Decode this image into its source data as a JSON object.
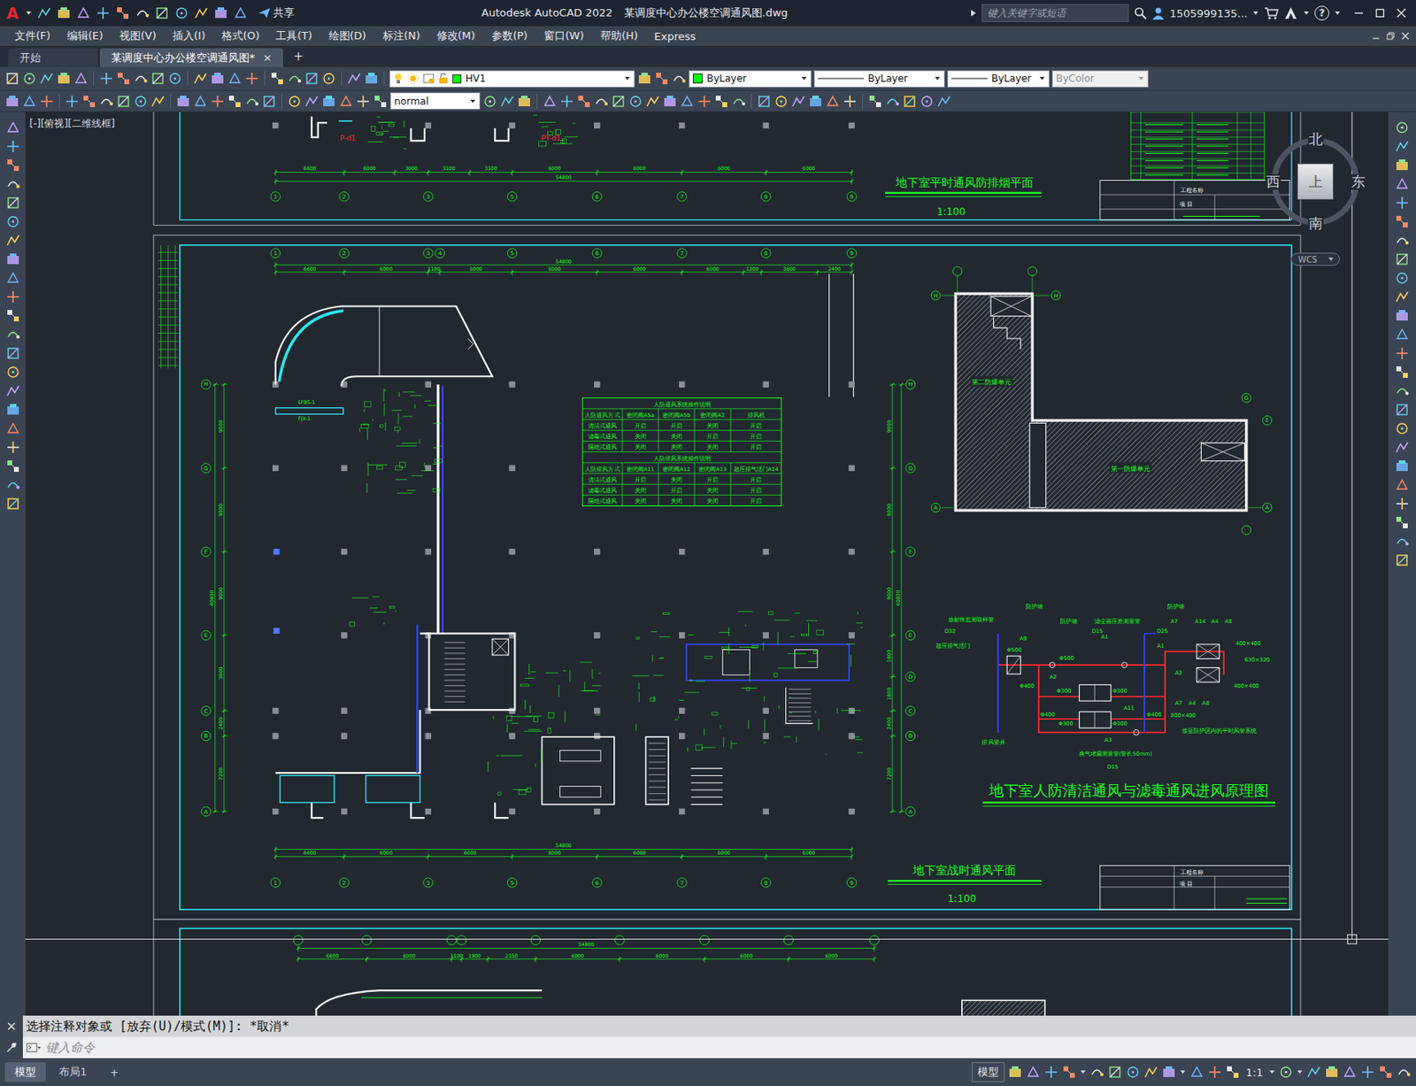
{
  "window": {
    "logo": "A",
    "app_name": "Autodesk AutoCAD 2022",
    "file": "某调度中心办公楼空调通风图.dwg",
    "share": "共享",
    "search_placeholder": "键入关键字或短语",
    "user": "1505999135...",
    "help": "?"
  },
  "menus": [
    "文件(F)",
    "编辑(E)",
    "视图(V)",
    "插入(I)",
    "格式(O)",
    "工具(T)",
    "绘图(D)",
    "标注(N)",
    "修改(M)",
    "参数(P)",
    "窗口(W)",
    "帮助(H)",
    "Express"
  ],
  "tabs": [
    {
      "label": "开始",
      "selected": false
    },
    {
      "label": "某调度中心办公楼空调通风图*",
      "selected": true
    }
  ],
  "tab_close": "×",
  "tab_add": "+",
  "properties": {
    "layer": "HV1",
    "layer_color": "#00ff00",
    "color": "ByLayer",
    "linetype": "ByLayer",
    "lineweight": "ByLayer",
    "plot_style": "ByColor",
    "text_style": "normal"
  },
  "viewport": {
    "label": "[-][俯视][二维线框]"
  },
  "viewcube": {
    "north": "北",
    "south": "南",
    "east": "东",
    "west": "西",
    "top": "上",
    "ucs": "WCS"
  },
  "drawing": {
    "sheet1": {
      "title": "地下室平时通风防排烟平面",
      "scale": "1:100",
      "axes": [
        "1",
        "2",
        "3",
        "5",
        "6",
        "7",
        "8",
        "9"
      ],
      "dims": [
        "6600",
        "6000",
        "3000",
        "3100",
        "3100",
        "6000",
        "6000",
        "6000",
        "6000"
      ],
      "total": "54800",
      "labels": [
        "P-d1",
        "PY-d1"
      ],
      "title_block": [
        "工程名称",
        "项 目"
      ]
    },
    "sheet2": {
      "title": "地下室战时通风平面",
      "scale": "1:100",
      "axes_top": [
        "1",
        "2",
        "3",
        "4",
        "5",
        "6",
        "7",
        "8",
        "9"
      ],
      "dims_top": [
        "6600",
        "6000",
        "1100",
        "6000",
        "6000",
        "6000",
        "6000",
        "1200",
        "3600",
        "2400"
      ],
      "total_top": "54800",
      "axes_bottom": [
        "1",
        "2",
        "3",
        "5",
        "6",
        "7",
        "8",
        "9"
      ],
      "dims_bottom": [
        "6600",
        "6000",
        "6000",
        "6000",
        "6000",
        "6000",
        "6000"
      ],
      "total_bottom": "54800",
      "axes_left": [
        "H",
        "G",
        "F",
        "E",
        "C",
        "B",
        "A"
      ],
      "dims_left": [
        "9000",
        "9000",
        "9000",
        "3600",
        "2400",
        "7200"
      ],
      "total_left": "40800",
      "axes_right": [
        "H",
        "G",
        "F",
        "E",
        "D",
        "C",
        "B",
        "A"
      ],
      "dims_right": [
        "9000",
        "9000",
        "9000",
        "1800",
        "1800",
        "2400",
        "7200"
      ],
      "total_right": "40800",
      "labels": [
        "LFBS-1",
        "FJX-1"
      ],
      "table": {
        "title": "人防通风系统操作说明",
        "header": [
          "人防通风方式",
          "密闭阀A5a",
          "密闭阀A5b",
          "密闭阀A2",
          "排风机"
        ],
        "rows": [
          [
            "清洁式通风",
            "开启",
            "开启",
            "关闭",
            "开启"
          ],
          [
            "滤毒式通风",
            "关闭",
            "关闭",
            "开启",
            "开启"
          ],
          [
            "隔绝式通风",
            "关闭",
            "关闭",
            "关闭",
            "开启"
          ]
        ],
        "title2": "人防排风系统操作说明",
        "header2": [
          "人防排风方式",
          "密闭阀A11",
          "密闭阀A12",
          "密闭阀A13",
          "超压排气活门A14"
        ],
        "rows2": [
          [
            "清洁式通风",
            "开启",
            "关闭",
            "开启",
            "开启"
          ],
          [
            "滤毒式通风",
            "关闭",
            "开启",
            "关闭",
            "开启"
          ],
          [
            "隔绝式通风",
            "关闭",
            "关闭",
            "关闭",
            "开启"
          ]
        ]
      },
      "plan": {
        "units": [
          "第二防爆单元",
          "第一防爆单元"
        ],
        "axes": [
          "H",
          "H",
          "G",
          "E",
          "A",
          "A"
        ]
      },
      "schematic": {
        "title": "地下室人防清洁通风与滤毒通风进风原理图",
        "labels": [
          "放射性监测取样管",
          "D32",
          "防护墙",
          "防护墙",
          "滤尘器压差测量管",
          "D15",
          "防护墙",
          "D25",
          "A7",
          "A14",
          "A4",
          "A8",
          "超压排气活门",
          "A9",
          "Φ500",
          "Φ500",
          "A1",
          "A1",
          "400×400",
          "630×320",
          "A2",
          "A2",
          "Φ400",
          "Φ300",
          "Φ300",
          "400×400",
          "A11",
          "A7",
          "A4",
          "A8",
          "Φ400",
          "Φ400",
          "800×400",
          "Φ300",
          "Φ300",
          "接至防护区内的平时风管系统",
          "A3",
          "排风竖井",
          "换气堵漏测量管(管长50mm)",
          "D15"
        ]
      },
      "title_block": [
        "工程名称",
        "项 目"
      ]
    },
    "sheet3": {
      "dims": [
        "6600",
        "6000",
        "1100",
        "1900",
        "2150",
        "6000",
        "6000",
        "6000",
        "6000"
      ],
      "total": "54800"
    }
  },
  "command": {
    "history": "选择注释对象或 [放弃(U)/模式(M)]: *取消*",
    "placeholder": "键入命令"
  },
  "layouts": [
    {
      "label": "模型",
      "selected": true
    },
    {
      "label": "布局1",
      "selected": false
    }
  ],
  "layout_add": "+",
  "status": {
    "space": "模型",
    "scale": "1:1"
  }
}
